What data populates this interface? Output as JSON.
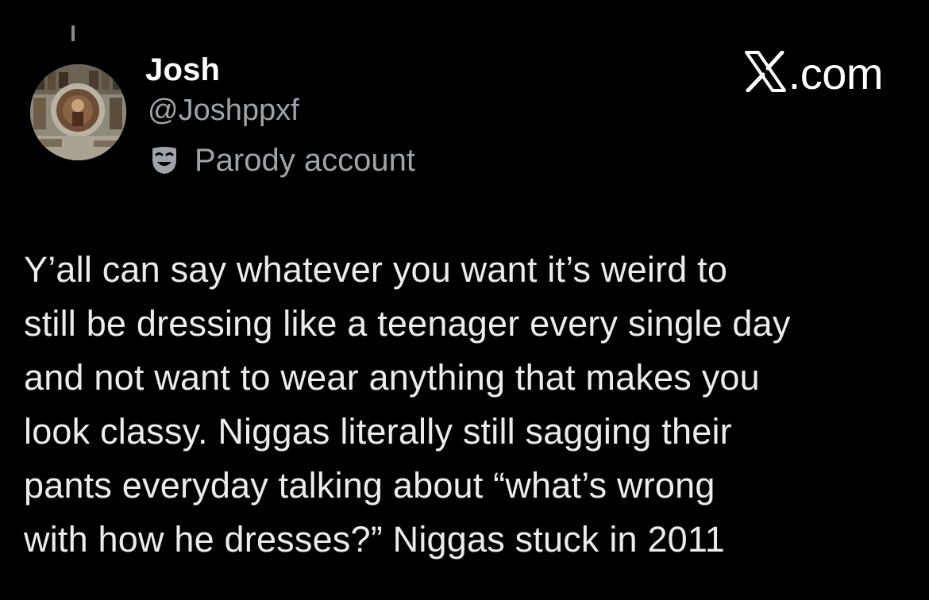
{
  "author": {
    "display_name": "Josh",
    "handle": "@Joshppxf",
    "badge_label": "Parody account",
    "badge_icon": "theater-mask-icon",
    "avatar_icon": "profile-avatar-image"
  },
  "site": {
    "label": ".com",
    "logo_icon": "x-logo-icon"
  },
  "tweet": {
    "lines": [
      "Y’all can say whatever you want it’s weird to",
      "still be dressing like a teenager every single day",
      "and not want to wear anything that makes you",
      "look classy. Niggas literally still sagging their",
      "pants everyday talking about “what’s wrong",
      "with how he dresses?” Niggas stuck in 2011"
    ]
  },
  "colors": {
    "background": "#000000",
    "primary_text": "#ffffff",
    "secondary_text": "#9ea4a9"
  }
}
